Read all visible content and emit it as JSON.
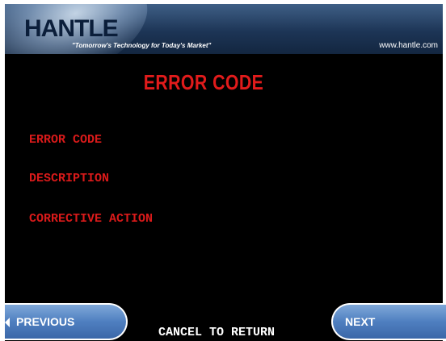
{
  "header": {
    "logo": "HANTLE",
    "tagline": "\"Tomorrow's Technology for Today's Market\"",
    "url": "www.hantle.com"
  },
  "main": {
    "title": "ERROR CODE",
    "fields": [
      "ERROR CODE",
      "DESCRIPTION",
      "CORRECTIVE ACTION"
    ]
  },
  "footer": {
    "previous_label": "PREVIOUS",
    "next_label": "NEXT",
    "cancel_text": "CANCEL TO RETURN"
  },
  "colors": {
    "background": "#000000",
    "title": "#e11b1b",
    "fields": "#d91a1a",
    "header": "#1d3556",
    "button": "#4f7fc0"
  },
  "icons": [
    "arrow-left-icon"
  ]
}
